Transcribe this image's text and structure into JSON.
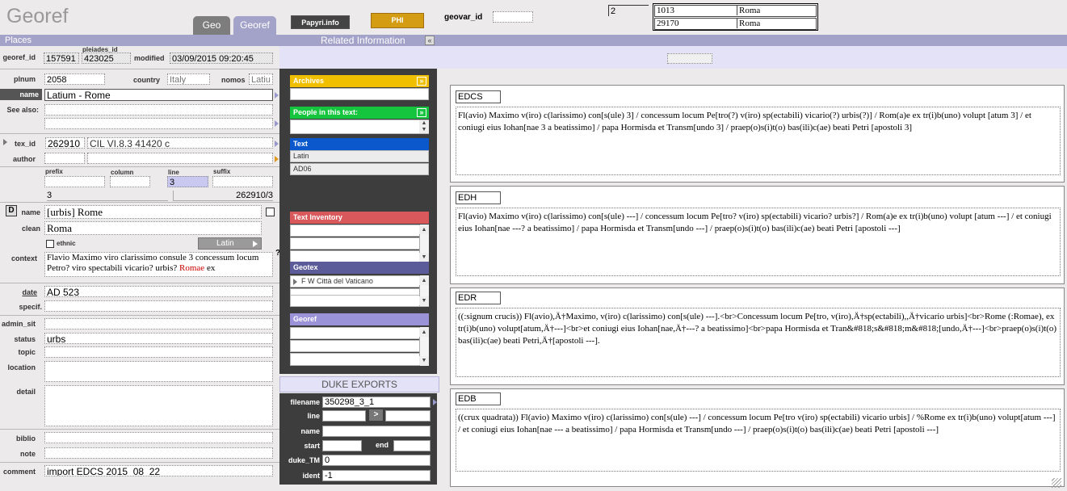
{
  "app": {
    "title": "Georef"
  },
  "tabs": [
    {
      "label": "Geo"
    },
    {
      "label": "Georef"
    }
  ],
  "toolbar": {
    "papyri_label": "Papyri.info",
    "phi_label": "PHI",
    "geovar_label": "geovar_id",
    "geovar_value": ""
  },
  "match": {
    "count": "2",
    "rows": [
      {
        "id": "1013",
        "name": "Roma"
      },
      {
        "id": "29170",
        "name": "Roma"
      }
    ]
  },
  "headers": {
    "places": "Places",
    "related": "Related Information",
    "collapse": "«"
  },
  "record": {
    "georef_label": "georef_id",
    "georef_id": "157591",
    "pleiades_label": "pleiades_id",
    "pleiades_id": "423025",
    "modified_label": "modified",
    "modified": "03/09/2015 09:20:45",
    "plnum_label": "plnum",
    "plnum": "2058",
    "country_label": "country",
    "country": "Italy",
    "nomos_label": "nomos",
    "nomos": "Latiu",
    "name_label": "name",
    "name": "Latium - Rome",
    "seealso_label": "See also:",
    "seealso1": "",
    "seealso2": "",
    "texid_label": "tex_id",
    "tex_id": "262910",
    "tex_ref": "CIL VI.8.3 41420 c",
    "author_label": "author",
    "author": "",
    "prefix_label": "prefix",
    "column_label": "column",
    "line_label": "line",
    "suffix_label": "suffix",
    "prefix": "",
    "column": "",
    "line": "3",
    "suffix": "",
    "line_value": "3",
    "composite": "262910/3",
    "d_button": "D",
    "name2_label": "name",
    "name2": "[urbis] Rome",
    "clean_label": "clean",
    "clean": "Roma",
    "ethnic_label": "ethnic",
    "language": "Latin",
    "context_label": "context",
    "context_text": "Flavio Maximo viro clarissimo consule 3 concessum locum Petro? viro spectabili vicario? urbis?",
    "context_highlight": "Romae",
    "context_tail": "ex",
    "question": "?",
    "date_label": "date",
    "date": "AD 523",
    "specif_label": "specif.",
    "specif": "",
    "admin_label": "admin_sit",
    "admin": "",
    "status_label": "status",
    "status": "urbs",
    "topic_label": "topic",
    "topic": "",
    "location_label": "location",
    "location": "",
    "detail_label": "detail",
    "detail": "",
    "biblio_label": "biblio",
    "biblio": "",
    "note_label": "note",
    "note": "",
    "comment_label": "comment",
    "comment": "import EDCS 2015_08_22"
  },
  "panels": {
    "archives": {
      "label": "Archives",
      "btn": "»"
    },
    "people": {
      "label": "People in this text:",
      "btn": "»"
    },
    "text": {
      "label": "Text",
      "rows": [
        "Latin",
        "AD06"
      ]
    },
    "inventory": {
      "label": "Text Inventory"
    },
    "geotex": {
      "label": "Geotex",
      "row": "F W  Città del Vaticano"
    },
    "georef": {
      "label": "Georef"
    }
  },
  "duke": {
    "title": "DUKE EXPORTS",
    "filename_label": "filename",
    "filename": "350298_3_1",
    "line_label": "line",
    "line_arrow": ">",
    "name_label": "name",
    "start_label": "start",
    "end_label": "end",
    "duketm_label": "duke_TM",
    "duketm": "0",
    "ident_label": "ident",
    "ident": "-1"
  },
  "sources": [
    {
      "label": "EDCS",
      "text": "Fl(avio) Maximo v(iro) c(larissimo) con[s(ule) 3] / concessum locum Pe[tro(?) v(iro) sp(ectabili) vicario(?) urbis(?)] / Rom(a)e ex tr(i)b(uno) volupt [atum 3] / et coniugi eius Iohan[nae 3 a beatissimo] / papa Hormisda et Transm[undo 3] / praep(o)s(i)t(o) bas(ili)c(ae) beati Petri [apostoli 3]"
    },
    {
      "label": "EDH",
      "text": "Fl(avio) Maximo v(iro) c(larissimo) con[s(ule) ---] / concessum locum Pe[tro? v(iro) sp(ectabili) vicario? urbis?] / Rom(a)e ex tr(i)b(uno) volupt [atum ---] / et coniugi eius Iohan[nae ---? a beatissimo] / papa Hormisda et Transm[undo ---] / praep(o)s(i)t(o) bas(ili)c(ae) beati Petri [apostoli ---]"
    },
    {
      "label": "EDR",
      "text": "((:signum crucis)) Fl(avio),Ä†Maximo, v(iro) c(larissimo) con[s(ule) ---].<br>Concessum locum Pe[tro, v(iro),Ä†sp(ectabili),,Ä†vicario urbis]<br>Rome (:Romae), ex tr(i)b(uno) volupt[atum,Ä†---]<br>et coniugi eius Iohan[nae,Ä†---? a beatissimo]<br>papa Hormisda et Tran&#818;s&#818;m&#818;[undo,Ä†---]<br>praep(o)s(i)t(o) bas(ili)c(ae) beati Petri,Ä†[apostoli ---]."
    },
    {
      "label": "EDB",
      "text": "((crux quadrata)) Fl(avio) Maximo v(iro) c(larissimo) con[s(ule) ---] / concessum locum Pe[tro v(iro) sp(ectabili) vicario urbis] / %Rome ex tr(i)b(uno) volupt[atum ---] / et coniugi eius Iohan[nae --- a beatissimo] / papa Hormisda et Transm[undo ---] / praep(o)s(i)t(o) bas(ili)c(ae) beati Petri [apostoli ---]"
    }
  ]
}
